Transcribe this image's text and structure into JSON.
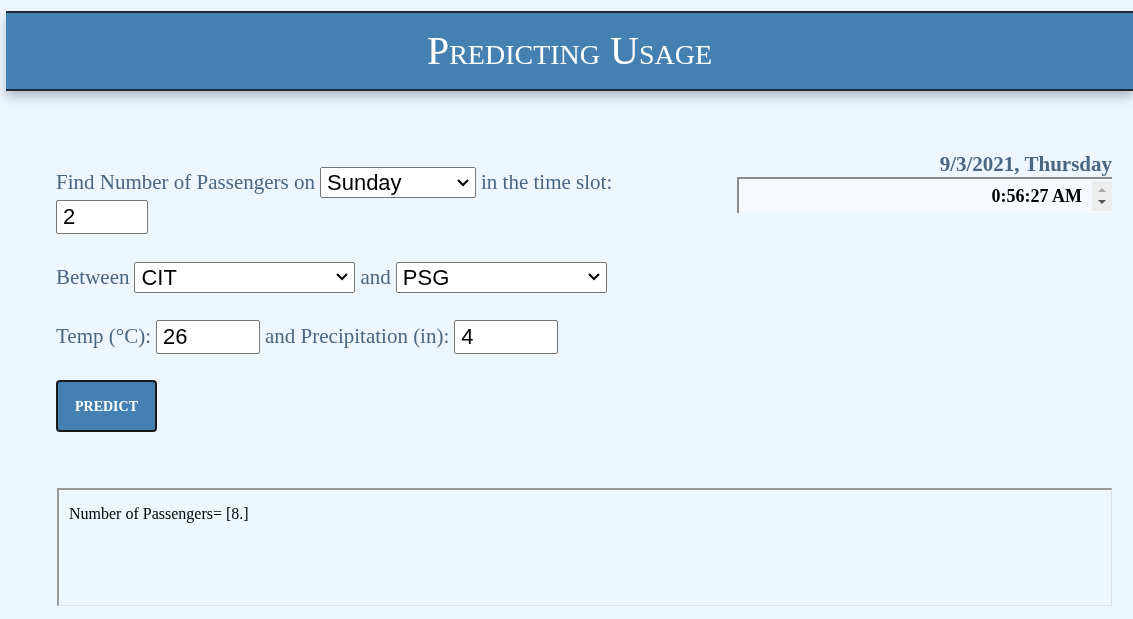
{
  "header": {
    "title": "Predicting Usage"
  },
  "clock": {
    "date": "9/3/2021, Thursday",
    "time": "0:56:27 AM"
  },
  "form": {
    "day_label": "Find Number of Passengers on",
    "day": "Sunday",
    "slot_label": "in the time slot:",
    "slot": "2",
    "between_label": "Between",
    "from": "CIT",
    "and_label": "and",
    "to": "PSG",
    "temp_label": "Temp (°C):",
    "temp": "26",
    "precip_label": "and Precipitation (in):",
    "precip": "4",
    "button": "PREDICT"
  },
  "output": {
    "text": "Number of Passengers= [8.]"
  }
}
